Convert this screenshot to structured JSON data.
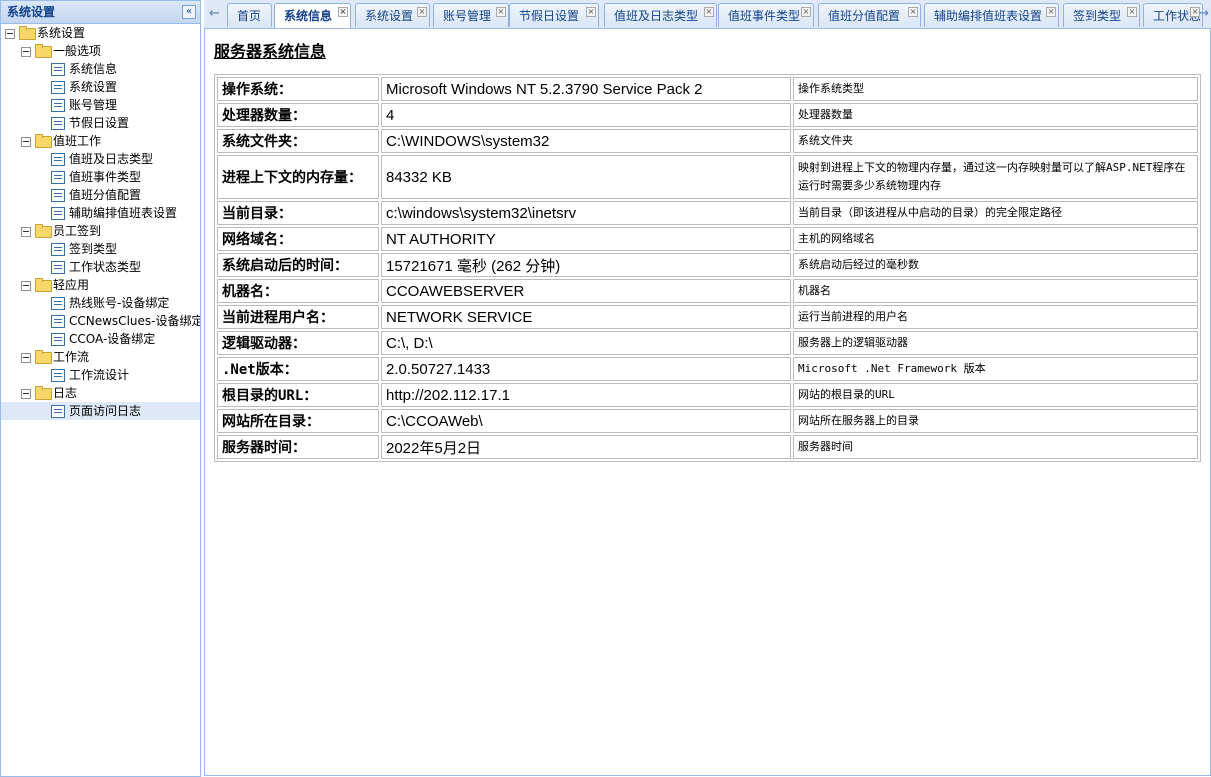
{
  "sidebar": {
    "title": "系统设置",
    "collapse_glyph": "«",
    "tree": [
      {
        "label": "系统设置",
        "type": "folder",
        "level": 0
      },
      {
        "label": "一般选项",
        "type": "folder",
        "level": 1
      },
      {
        "label": "系统信息",
        "type": "leaf",
        "level": 2
      },
      {
        "label": "系统设置",
        "type": "leaf",
        "level": 2
      },
      {
        "label": "账号管理",
        "type": "leaf",
        "level": 2
      },
      {
        "label": "节假日设置",
        "type": "leaf",
        "level": 2
      },
      {
        "label": "值班工作",
        "type": "folder",
        "level": 1
      },
      {
        "label": "值班及日志类型",
        "type": "leaf",
        "level": 2
      },
      {
        "label": "值班事件类型",
        "type": "leaf",
        "level": 2
      },
      {
        "label": "值班分值配置",
        "type": "leaf",
        "level": 2
      },
      {
        "label": "辅助编排值班表设置",
        "type": "leaf",
        "level": 2
      },
      {
        "label": "员工签到",
        "type": "folder",
        "level": 1
      },
      {
        "label": "签到类型",
        "type": "leaf",
        "level": 2
      },
      {
        "label": "工作状态类型",
        "type": "leaf",
        "level": 2
      },
      {
        "label": "轻应用",
        "type": "folder",
        "level": 1
      },
      {
        "label": "热线账号-设备绑定",
        "type": "leaf",
        "level": 2
      },
      {
        "label": "CCNewsClues-设备绑定",
        "type": "leaf",
        "level": 2
      },
      {
        "label": "CCOA-设备绑定",
        "type": "leaf",
        "level": 2
      },
      {
        "label": "工作流",
        "type": "folder",
        "level": 1
      },
      {
        "label": "工作流设计",
        "type": "leaf",
        "level": 2
      },
      {
        "label": "日志",
        "type": "folder",
        "level": 1
      },
      {
        "label": "页面访问日志",
        "type": "leaf",
        "level": 2,
        "selected": true
      }
    ]
  },
  "tabbar": {
    "left_arrow": "←",
    "right_arrow": "→",
    "close_glyph": "×",
    "tabs": [
      {
        "label": "首页",
        "closable": false
      },
      {
        "label": "系统信息",
        "closable": true,
        "active": true
      },
      {
        "label": "系统设置",
        "closable": true
      },
      {
        "label": "账号管理",
        "closable": true
      },
      {
        "label": "节假日设置",
        "closable": true
      },
      {
        "label": "值班及日志类型",
        "closable": true
      },
      {
        "label": "值班事件类型",
        "closable": true
      },
      {
        "label": "值班分值配置",
        "closable": true
      },
      {
        "label": "辅助编排值班表设置",
        "closable": true
      },
      {
        "label": "签到类型",
        "closable": true
      },
      {
        "label": "工作状态",
        "closable": true
      }
    ]
  },
  "main": {
    "title": "服务器系统信息",
    "rows": [
      {
        "key": "操作系统：",
        "value": "Microsoft Windows NT 5.2.3790 Service Pack 2",
        "desc": "操作系统类型"
      },
      {
        "key": "处理器数量：",
        "value": "4",
        "desc": "处理器数量"
      },
      {
        "key": "系统文件夹：",
        "value": "C:\\WINDOWS\\system32",
        "desc": "系统文件夹"
      },
      {
        "key": "进程上下文的内存量：",
        "value": "84332 KB",
        "desc": "映射到进程上下文的物理内存量，通过这一内存映射量可以了解ASP.NET程序在运行时需要多少系统物理内存"
      },
      {
        "key": "当前目录：",
        "value": "c:\\windows\\system32\\inetsrv",
        "desc": "当前目录（即该进程从中启动的目录）的完全限定路径"
      },
      {
        "key": "网络域名：",
        "value": "NT AUTHORITY",
        "desc": "主机的网络域名"
      },
      {
        "key": "系统启动后的时间：",
        "value": "15721671 毫秒 (262 分钟)",
        "desc": "系统启动后经过的毫秒数"
      },
      {
        "key": "机器名：",
        "value": "CCOAWEBSERVER",
        "desc": "机器名"
      },
      {
        "key": "当前进程用户名：",
        "value": "NETWORK SERVICE",
        "desc": "运行当前进程的用户名"
      },
      {
        "key": "逻辑驱动器：",
        "value": "C:\\, D:\\",
        "desc": "服务器上的逻辑驱动器"
      },
      {
        "key": ".Net版本：",
        "value": "2.0.50727.1433",
        "desc": "Microsoft .Net Framework 版本"
      },
      {
        "key": "根目录的URL：",
        "value": "http://202.112.17.1",
        "desc": "网站的根目录的URL"
      },
      {
        "key": "网站所在目录：",
        "value": "C:\\CCOAWeb\\",
        "desc": "网站所在服务器上的目录"
      },
      {
        "key": "服务器时间：",
        "value": "2022年5月2日",
        "desc": "服务器时间"
      }
    ]
  }
}
